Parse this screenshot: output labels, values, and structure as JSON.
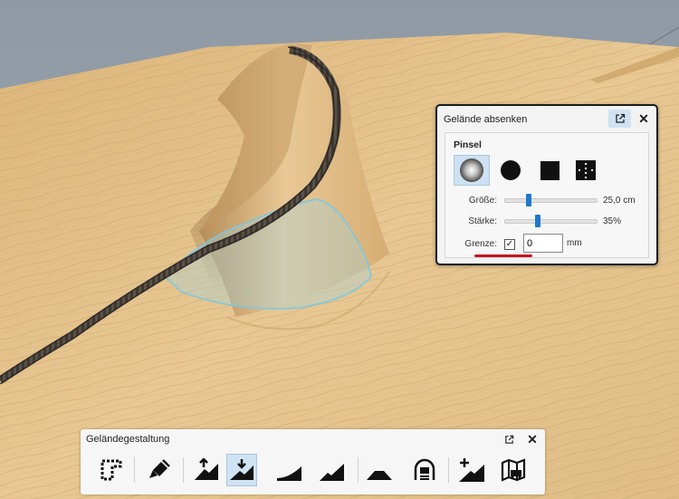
{
  "panel": {
    "title": "Gelände absenken",
    "close_glyph": "✕",
    "popout_icon": "popout-icon",
    "group_title": "Pinsel",
    "brushes": [
      {
        "name": "soft-brush-icon",
        "selected": true
      },
      {
        "name": "circle-brush-icon",
        "selected": false
      },
      {
        "name": "square-brush-icon",
        "selected": false
      },
      {
        "name": "pattern-brush-icon",
        "selected": false
      }
    ],
    "size": {
      "label": "Größe:",
      "value": "25,0 cm",
      "level": 0.25
    },
    "strength": {
      "label": "Stärke:",
      "value": "35%",
      "level": 0.35
    },
    "border": {
      "label": "Grenze:",
      "checked": true,
      "check_glyph": "✓",
      "value": "0",
      "unit": "mm"
    }
  },
  "toolbar": {
    "title": "Geländegestaltung",
    "close_glyph": "✕",
    "popout_icon": "popout-icon",
    "tools": [
      {
        "name": "terrain-outline-tool-icon",
        "active": false
      },
      {
        "name": "terrain-paint-brush-icon",
        "active": false
      },
      {
        "name": "terrain-raise-icon",
        "active": false
      },
      {
        "name": "terrain-lower-icon",
        "active": true
      },
      {
        "name": "terrain-ramp-icon",
        "active": false
      },
      {
        "name": "terrain-smooth-ramp-icon",
        "active": false
      },
      {
        "name": "terrain-embankment-icon",
        "active": false
      },
      {
        "name": "tunnel-portal-icon",
        "active": false
      },
      {
        "name": "add-terrain-icon",
        "active": false
      },
      {
        "name": "terrain-map-icon",
        "active": false
      }
    ]
  },
  "colors": {
    "accent": "#1e78c8",
    "selection": "#cfe3f3",
    "highlight_red": "#c8141e",
    "wood": "#e2bf86"
  }
}
